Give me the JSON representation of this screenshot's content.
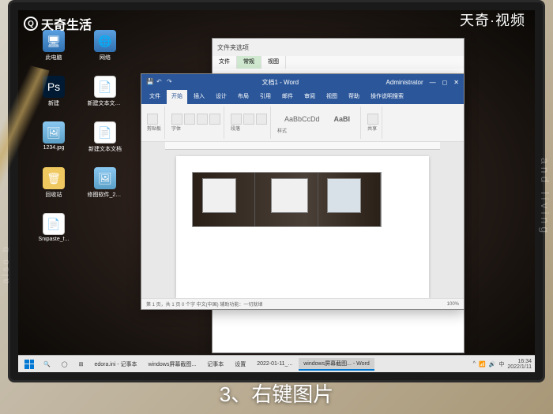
{
  "watermark": {
    "top_left": "天奇生活",
    "top_right": "天奇·视频"
  },
  "caption": "3、右键图片",
  "desktop": {
    "icons": [
      {
        "name": "此电脑"
      },
      {
        "name": "网络"
      },
      {
        "name": "新建"
      },
      {
        "name": "新建文本文档.txt"
      },
      {
        "name": "1234.jpg"
      },
      {
        "name": "新建文本文档"
      },
      {
        "name": "回收站"
      },
      {
        "name": "修图软件_20220111..."
      },
      {
        "name": "Snipaste_f..."
      }
    ]
  },
  "back_window": {
    "tabs": [
      "文件",
      "常规",
      "视图"
    ],
    "title": "文件夹选项"
  },
  "word": {
    "title": "文档1 - Word",
    "user": "Administrator",
    "menu": [
      "文件",
      "开始",
      "插入",
      "设计",
      "布局",
      "引用",
      "邮件",
      "审阅",
      "视图",
      "帮助",
      "操作说明搜索"
    ],
    "clipboard_label": "剪贴板",
    "font_label": "字体",
    "para_label": "段落",
    "style1": "AaBbCcDd",
    "style2": "AaBI",
    "styles_label": "样式",
    "share_label": "共享",
    "status_left": "第 1 页，共 1 页  0 个字  中文(中国)  辅助功能：一切就绪",
    "status_right": "100%"
  },
  "taskbar": {
    "items": [
      "",
      "edora.ini - 记事本",
      "windows屏幕截图...",
      "记事本",
      "设置",
      "2022-01-11_...",
      "windows屏幕截图... - Word"
    ],
    "time": "16:34",
    "date": "2022/1/11"
  },
  "decor": {
    "side_r": "and living",
    "side_l": "also b"
  }
}
